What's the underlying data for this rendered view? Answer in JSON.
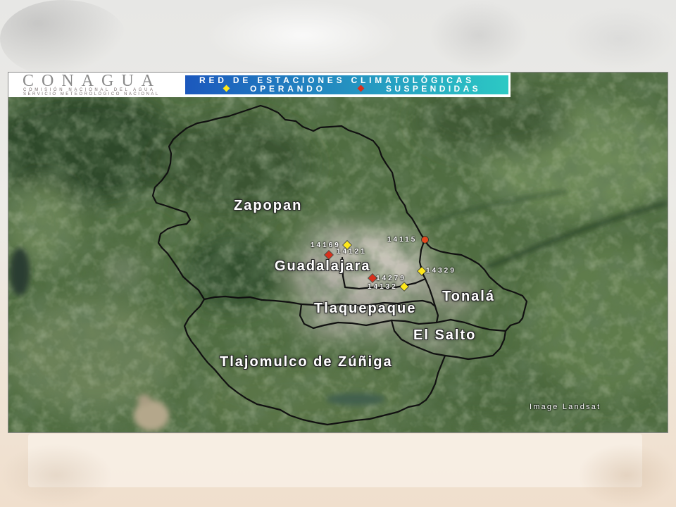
{
  "header": {
    "logo": {
      "name": "CONAGUA",
      "subtitle_1": "COMISIÓN NACIONAL DEL AGUA",
      "subtitle_2": "SERVICIO METEOROLÓGICO NACIONAL"
    },
    "legend": {
      "title": "RED DE ESTACIONES CLIMATOLÓGICAS",
      "background": [
        "#1c58bd",
        "#2cc9c4"
      ],
      "items": [
        {
          "label": "OPERANDO",
          "color": "#ffe81a",
          "icon": "diamond-marker-icon"
        },
        {
          "label": "SUSPENDIDAS",
          "color": "#d8301c",
          "icon": "diamond-marker-icon"
        }
      ]
    }
  },
  "map": {
    "municipalities": [
      "Zapopan",
      "Guadalajara",
      "Tlaquepaque",
      "Tonalá",
      "El Salto",
      "Tlajomulco de Zúñiga"
    ],
    "stations": [
      {
        "id": "14169",
        "color": "#ffe81a",
        "icon": "diamond-marker-icon"
      },
      {
        "id": "14121",
        "color": "#d8301c",
        "icon": "diamond-marker-icon"
      },
      {
        "id": "14115",
        "color": "#e2481e",
        "icon": "circle-marker-icon"
      },
      {
        "id": "14329",
        "color": "#ffe81a",
        "icon": "diamond-marker-icon"
      },
      {
        "id": "14279",
        "color": "#d8301c",
        "icon": "diamond-marker-icon"
      },
      {
        "id": "14132",
        "color": "#ffe81a",
        "icon": "diamond-marker-icon"
      }
    ],
    "boundary_color": "#111111",
    "credit": "Image Landsat"
  }
}
